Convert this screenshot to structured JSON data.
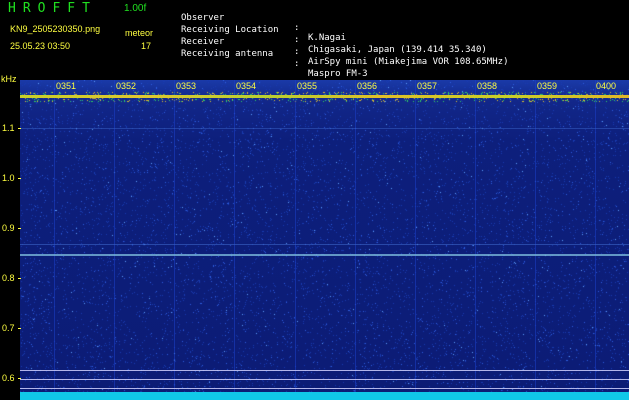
{
  "header": {
    "app_title": "HROFFT",
    "version": "1.00f",
    "filename": "KN9_2505230350.png",
    "datetime": "25.05.23 03:50",
    "meteor_label": "meteor",
    "meteor_count": "17"
  },
  "info": [
    {
      "key": "Observer",
      "value": "K.Nagai"
    },
    {
      "key": "Receiving Location",
      "value": "Chigasaki, Japan (139.414 35.340)"
    },
    {
      "key": "Receiver",
      "value": "AirSpy mini (Miakejima VOR 108.65MHz)"
    },
    {
      "key": "Receiving antenna",
      "value": "Maspro FM-3"
    }
  ],
  "colon": ":",
  "plot": {
    "unit_label": "kHz",
    "time_labels": [
      "0351",
      "0352",
      "0353",
      "0354",
      "0355",
      "0356",
      "0357",
      "0358",
      "0359",
      "0400"
    ],
    "freq_labels": [
      "1.1",
      "1.0",
      "0.9",
      "0.8",
      "0.7",
      "0.6"
    ],
    "colors": {
      "label": "#ffff40",
      "background": "#0c1c76",
      "carrier": "#c8d028",
      "trace": "#ffffff",
      "baseline": "#10c8e8"
    }
  }
}
